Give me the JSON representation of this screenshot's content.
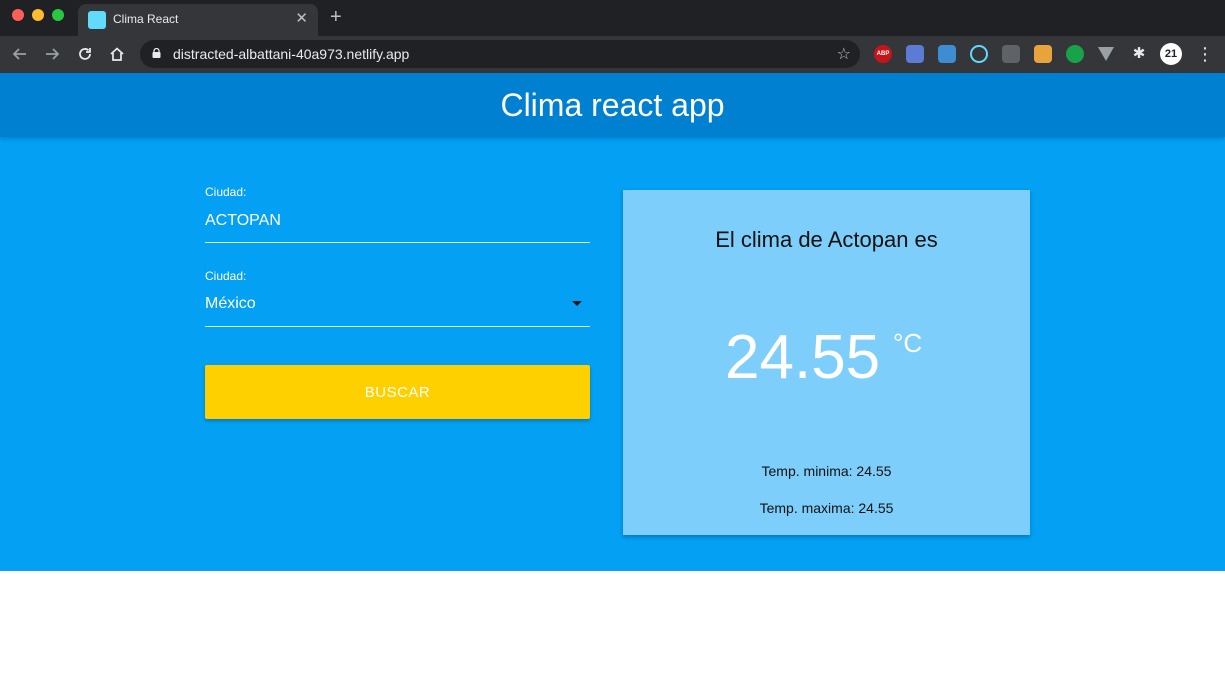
{
  "browser": {
    "tab_title": "Clima React",
    "close_glyph": "✕",
    "new_tab_glyph": "+",
    "url": "distracted-albattani-40a973.netlify.app",
    "profile_label": "21",
    "extensions": [
      "adblock-plus-icon",
      "ext-icon",
      "search-ext-icon",
      "react-devtools-icon",
      "lighthouse-icon",
      "palette-ext-icon",
      "evernote-icon",
      "vue-devtools-icon",
      "puzzle-icon"
    ],
    "abp_label": "ABP"
  },
  "header": {
    "title": "Clima react app",
    "color": "#0080d0"
  },
  "form": {
    "city_label": "Ciudad:",
    "city_value": "ACTOPAN",
    "country_label": "Ciudad:",
    "country_value": "México",
    "search_label": "BUSCAR",
    "button_color": "#ffd000",
    "background_color": "#03a0f4"
  },
  "result": {
    "title": "El clima de Actopan es",
    "temperature": "24.55",
    "unit": "°C",
    "temp_min": "Temp. minima: 24.55",
    "temp_max": "Temp. maxima: 24.55",
    "card_color": "#7dcefb"
  }
}
